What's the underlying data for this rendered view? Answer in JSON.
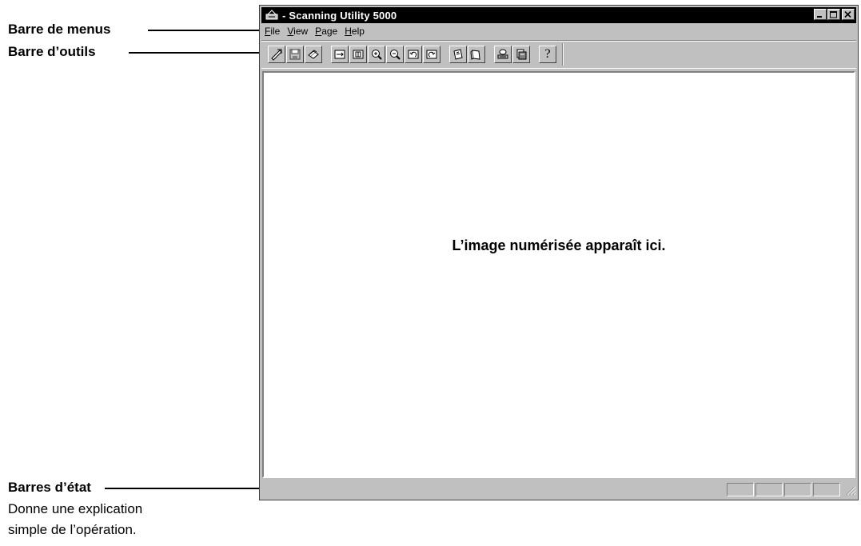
{
  "annotations": {
    "menubar_label": "Barre de menus",
    "toolbar_label": "Barre d’outils",
    "statusbar_label": "Barres d’état",
    "statusbar_desc_1": "Donne une explication",
    "statusbar_desc_2": "simple de l’opération."
  },
  "window": {
    "title": "- Scanning Utility 5000",
    "app_icon": "scanner-app-icon",
    "controls": [
      "minimize-icon",
      "maximize-icon",
      "close-icon"
    ]
  },
  "menubar": {
    "items": [
      {
        "first": "F",
        "rest": "ile"
      },
      {
        "first": "V",
        "rest": "iew"
      },
      {
        "first": "P",
        "rest": "age"
      },
      {
        "first": "H",
        "rest": "elp"
      }
    ]
  },
  "toolbar": {
    "groups": [
      [
        "acquire-icon",
        "save-icon",
        "print-icon"
      ],
      [
        "fit-width-icon",
        "fit-page-icon",
        "zoom-in-icon",
        "zoom-out-icon",
        "rotate-left-icon",
        "rotate-right-icon"
      ],
      [
        "previous-page-icon",
        "next-page-icon"
      ],
      [
        "scan-settings-icon",
        "send-icon"
      ],
      [
        "help-icon"
      ]
    ],
    "help_glyph": "?"
  },
  "client": {
    "message": "L’image numérisée apparaît ici."
  },
  "statusbar": {
    "text": "",
    "panel_count": 4
  }
}
